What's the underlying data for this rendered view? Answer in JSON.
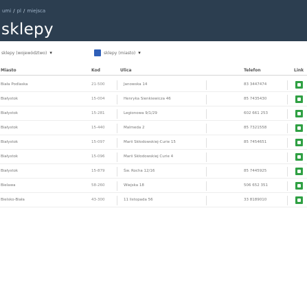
{
  "breadcrumb": {
    "home": "umi",
    "country": "pl",
    "current": "miejsca"
  },
  "page": {
    "title": "sklepy"
  },
  "filters": {
    "region": {
      "label": "sklepy (województwo)"
    },
    "city": {
      "label": "sklepy (miasto)"
    }
  },
  "table": {
    "headers": {
      "city": "Miasto",
      "code": "Kod",
      "street": "Ulica",
      "phone": "Telefon",
      "link": "Link"
    },
    "rows": [
      {
        "city": "Biała Podlaska",
        "code": "21-500",
        "street": "Janowska 14",
        "phone": "83 3447474"
      },
      {
        "city": "Białystok",
        "code": "15-004",
        "street": "Henryka Sienkiewicza 46",
        "phone": "85 7435430"
      },
      {
        "city": "Białystok",
        "code": "15-281",
        "street": "Legionowa 9/1/29",
        "phone": "602 661 253"
      },
      {
        "city": "Białystok",
        "code": "15-440",
        "street": "Malmeda 2",
        "phone": "85 7321558"
      },
      {
        "city": "Białystok",
        "code": "15-097",
        "street": "Marii Skłodowskiej-Curie 15",
        "phone": "85 7454651"
      },
      {
        "city": "Białystok",
        "code": "15-096",
        "street": "Marii Skłodowskiej Curie 4",
        "phone": ""
      },
      {
        "city": "Białystok",
        "code": "15-879",
        "street": "Św. Rocha 12/16",
        "phone": "85 7445925"
      },
      {
        "city": "Bielawa",
        "code": "58-260",
        "street": "Wiejska 18",
        "phone": "506 652 351"
      },
      {
        "city": "Bielsko-Biała",
        "code": "43-300",
        "street": "11 listopada 56",
        "phone": "33 8189010"
      }
    ]
  }
}
